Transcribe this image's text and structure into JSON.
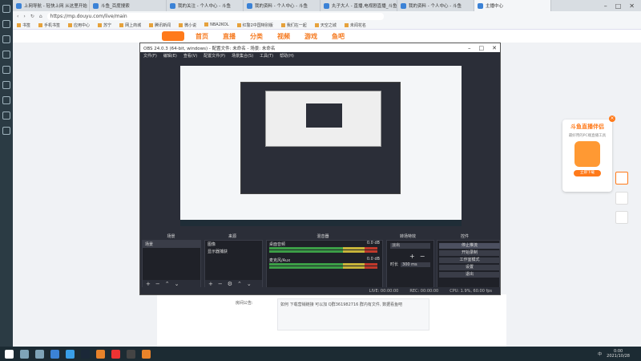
{
  "browser": {
    "tabs": [
      {
        "label": "上网导航 - 轻快上网 从这里开始"
      },
      {
        "label": "斗鱼_百度搜索"
      },
      {
        "label": "我的关注 - 个人中心 - 斗鱼"
      },
      {
        "label": "我的资料 - 个人中心 - 斗鱼"
      },
      {
        "label": "丸子大人 - 直播,电视剧直播_斗鱼"
      },
      {
        "label": "我的资料 - 个人中心 - 斗鱼"
      },
      {
        "label": "主播中心"
      }
    ],
    "url": "https://mp.douyu.com/live/main",
    "bookmarks": [
      "书签",
      "手机书签",
      "应用中心",
      "苏宁",
      "网上商城",
      "腾讯新闻",
      "微小说",
      "NBA2KOL",
      "红警2中国特别版",
      "我们在一起",
      "天空之城",
      "未闻花名"
    ]
  },
  "site": {
    "nav": [
      "首页",
      "直播",
      "分类",
      "视频",
      "游戏",
      "鱼吧"
    ],
    "notice_label": "房间公告:",
    "notice_text": "如何 下载营销链接 可以加 Q群361982716 群内有文件, 数据看鱼吧"
  },
  "ad": {
    "title": "斗鱼直播伴侣",
    "subtitle": "最好用的PC端直播工具",
    "button": "立即下载"
  },
  "obs": {
    "title": "OBS 24.0.3 (64-bit, windows) - 配置文件: 未命名 - 场景: 未命名",
    "menu": [
      "文件(F)",
      "编辑(E)",
      "查看(V)",
      "配置文件(P)",
      "场景集合(S)",
      "工具(T)",
      "帮助(H)"
    ],
    "docks": {
      "scenes": {
        "title": "场景",
        "items": [
          "场景"
        ]
      },
      "sources": {
        "title": "来源",
        "items": [
          "图像",
          "显示器捕获"
        ]
      },
      "mixer": {
        "title": "混音器",
        "rows": [
          {
            "name": "桌面音频",
            "db": "0.0 dB"
          },
          {
            "name": "麦克风/Aux",
            "db": "0.0 dB"
          }
        ]
      },
      "transitions": {
        "title": "转场特效",
        "type": "淡出",
        "duration_label": "时长",
        "duration": "300 ms"
      },
      "controls": {
        "title": "控件",
        "buttons": [
          "停止推流",
          "开始录制",
          "工作室模式",
          "设置",
          "退出"
        ]
      }
    },
    "status": {
      "live": "LIVE: 00:00:00",
      "rec": "REC: 00:00:00",
      "cpu": "CPU: 1.9%, 60.00 fps"
    }
  },
  "taskbar": {
    "tray_language": "中",
    "time": "0:00",
    "date": "2021/10/28"
  },
  "colors": {
    "accent": "#ff7a1a",
    "obs_bg": "#2b2e38",
    "taskbar": "#1c2b33"
  }
}
